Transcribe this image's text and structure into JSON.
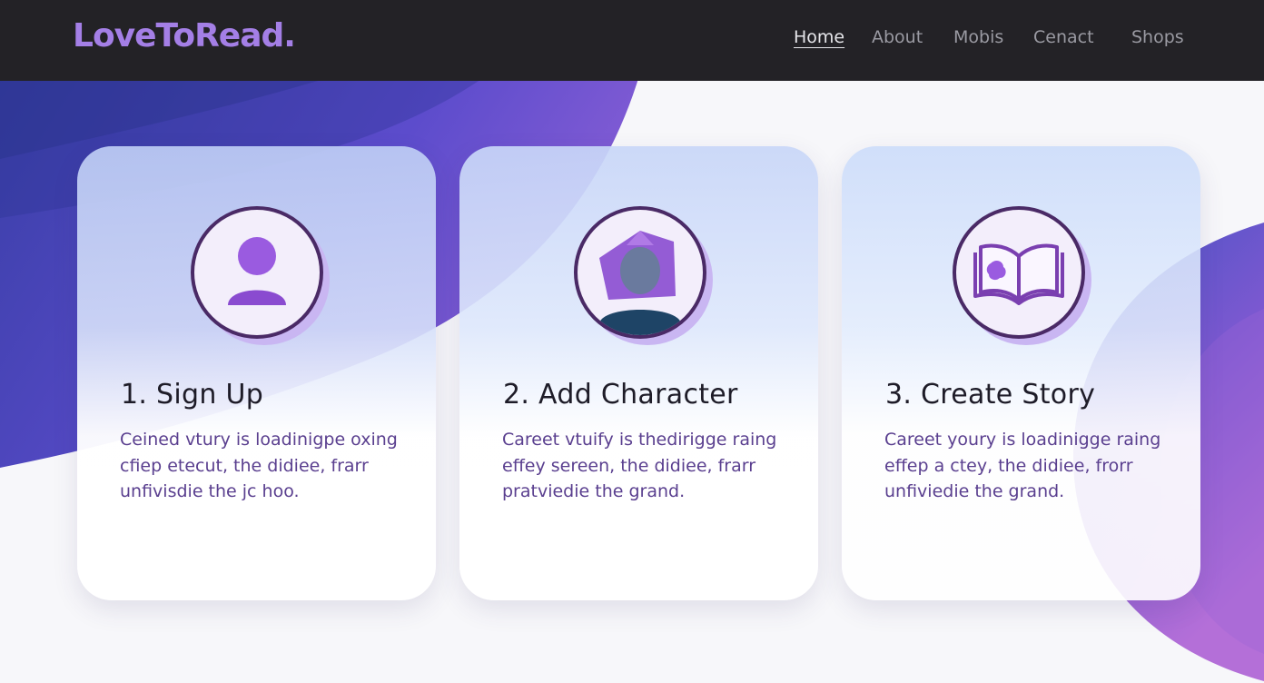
{
  "header": {
    "logo": "LoveToRead.",
    "nav": [
      {
        "label": "Home",
        "active": true
      },
      {
        "label": "About",
        "active": false
      },
      {
        "label": "Mobis",
        "active": false
      },
      {
        "label": "Cenact",
        "active": false
      },
      {
        "label": "Shops",
        "active": false
      }
    ]
  },
  "steps": [
    {
      "title": "1. Sign Up",
      "icon": "user-icon",
      "body_lines": [
        "Ceined vtury is loadinigpe oxing",
        "cfiep etecut, the didiee, frarr",
        "unfivisdie the jc hoo."
      ]
    },
    {
      "title": "2. Add Character",
      "icon": "character-portrait-icon",
      "body_lines": [
        "Careet vtuify is thedirigge raing",
        "effey sereen, the didiee, frarr",
        "pratviedie the grand."
      ]
    },
    {
      "title": "3. Create Story",
      "icon": "open-book-icon",
      "body_lines": [
        "Careet youry is loadinigge raing",
        "effep a ctey, the didiee, frorr",
        "unfiviedie the grand."
      ]
    }
  ],
  "colors": {
    "header_bg": "#232226",
    "logo": "#a47fe6",
    "nav_text": "#9a9aa2",
    "nav_active": "#e6e6ea",
    "icon_ring": "#4a2a66",
    "icon_fill": "#9a5be0",
    "body_text": "#5a3f8f",
    "title_text": "#1e1c28"
  }
}
